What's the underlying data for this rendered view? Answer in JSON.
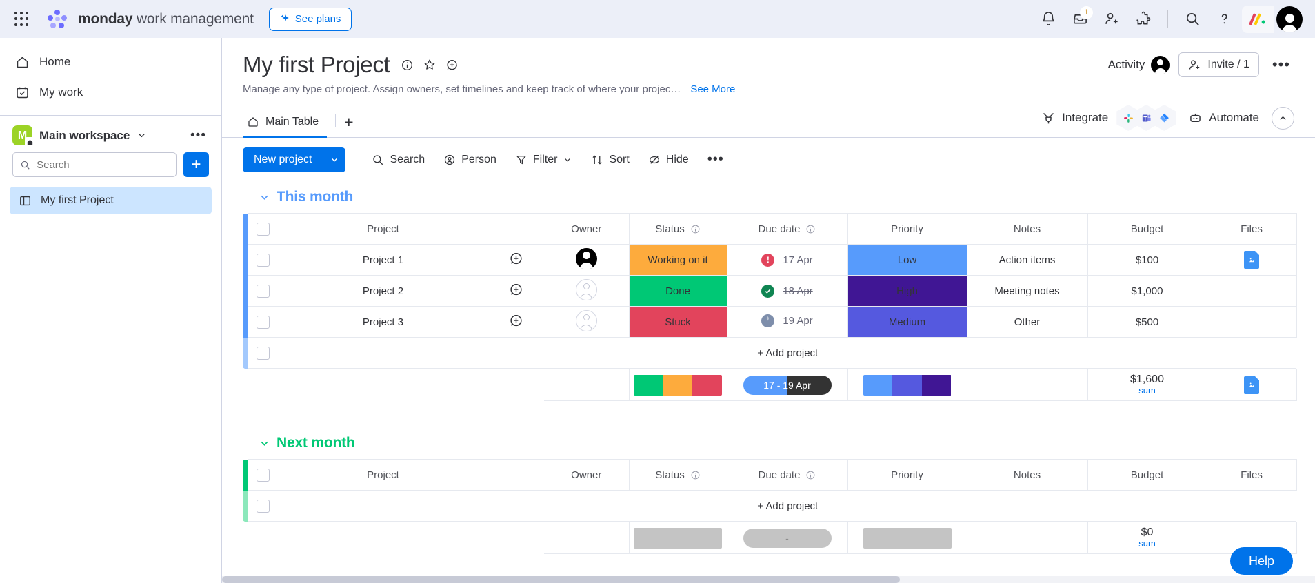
{
  "topbar": {
    "brand_bold": "monday",
    "brand_rest": " work management",
    "see_plans": "See plans",
    "icons": [
      {
        "name": "apps-grid-icon"
      },
      {
        "name": "notifications-bell-icon"
      },
      {
        "name": "inbox-icon",
        "badge": "1"
      },
      {
        "name": "invite-member-icon"
      },
      {
        "name": "apps-marketplace-icon"
      },
      {
        "name": "search-icon"
      },
      {
        "name": "help-question-icon"
      },
      {
        "name": "monday-product-switcher-icon"
      },
      {
        "name": "user-avatar"
      }
    ],
    "inbox_badge": "1"
  },
  "sidebar": {
    "nav": [
      {
        "label": "Home",
        "icon": "home-icon"
      },
      {
        "label": "My work",
        "icon": "my-work-calendar-icon"
      }
    ],
    "workspace": {
      "initial": "M",
      "name": "Main workspace",
      "menu": "•••"
    },
    "search_placeholder": "Search",
    "add_label": "+",
    "boards": [
      {
        "label": "My first Project",
        "icon": "board-icon",
        "selected": true
      }
    ]
  },
  "board": {
    "title": "My first Project",
    "description": "Manage any type of project. Assign owners, set timelines and keep track of where your projec…",
    "see_more": "See More",
    "activity_label": "Activity",
    "invite_label": "Invite / 1",
    "more_label": "•••"
  },
  "tabs": {
    "items": [
      {
        "label": "Main Table",
        "icon": "home-icon",
        "active": true
      }
    ],
    "add_label": "+",
    "integrate_label": "Integrate",
    "automate_label": "Automate",
    "integrations": [
      "slack-icon",
      "teams-icon",
      "jira-icon"
    ]
  },
  "toolbar": {
    "new_project": "New project",
    "items": [
      {
        "label": "Search",
        "icon": "search-icon"
      },
      {
        "label": "Person",
        "icon": "person-icon"
      },
      {
        "label": "Filter",
        "icon": "filter-icon",
        "caret": true
      },
      {
        "label": "Sort",
        "icon": "sort-icon"
      },
      {
        "label": "Hide",
        "icon": "hide-eye-icon"
      }
    ],
    "more": "•••"
  },
  "columns": [
    "Project",
    "Owner",
    "Status",
    "Due date",
    "Priority",
    "Notes",
    "Budget",
    "Files"
  ],
  "groups": [
    {
      "name": "This month",
      "color": "#579bfc",
      "add_row_label": "+ Add project",
      "rows": [
        {
          "project": "Project 1",
          "owner": "filled",
          "status": {
            "label": "Working on it",
            "color": "#fdab3d"
          },
          "due": {
            "date": "17 Apr",
            "indicator": "overdue",
            "indicator_color": "#e2445c",
            "struck": false
          },
          "priority": {
            "label": "Low",
            "color": "#579bfc"
          },
          "notes": "Action items",
          "budget": "$100",
          "file": true
        },
        {
          "project": "Project 2",
          "owner": "empty",
          "status": {
            "label": "Done",
            "color": "#00c875"
          },
          "due": {
            "date": "18 Apr",
            "indicator": "done",
            "indicator_color": "#0f8552",
            "struck": true
          },
          "priority": {
            "label": "High",
            "color": "#401694"
          },
          "notes": "Meeting notes",
          "budget": "$1,000",
          "file": false
        },
        {
          "project": "Project 3",
          "owner": "empty",
          "status": {
            "label": "Stuck",
            "color": "#e2445c"
          },
          "due": {
            "date": "19 Apr",
            "indicator": "pending",
            "indicator_color": "#7e8eab",
            "struck": false
          },
          "priority": {
            "label": "Medium",
            "color": "#5559df"
          },
          "notes": "Other",
          "budget": "$500",
          "file": false
        }
      ],
      "summary": {
        "status_bar": [
          {
            "color": "#00c875",
            "pct": 33.3
          },
          {
            "color": "#fdab3d",
            "pct": 33.3
          },
          {
            "color": "#e2445c",
            "pct": 33.4
          }
        ],
        "date_pill": {
          "text": "17 - 19 Apr",
          "left_color": "#579bfc",
          "right_color": "#333333",
          "fill_pct": 50
        },
        "priority_bar": [
          {
            "color": "#579bfc",
            "pct": 33.3
          },
          {
            "color": "#5559df",
            "pct": 33.3
          },
          {
            "color": "#401694",
            "pct": 33.4
          }
        ],
        "budget_value": "$1,600",
        "budget_label": "sum",
        "file": true
      }
    },
    {
      "name": "Next month",
      "color": "#00c875",
      "add_row_label": "+ Add project",
      "rows": [],
      "summary": {
        "status_bar": [
          {
            "color": "#c4c4c4",
            "pct": 100
          }
        ],
        "date_pill": {
          "text": "-",
          "left_color": "#c4c4c4",
          "right_color": "#c4c4c4",
          "fill_pct": 100
        },
        "priority_bar": [
          {
            "color": "#c4c4c4",
            "pct": 100
          }
        ],
        "budget_value": "$0",
        "budget_label": "sum",
        "file": false
      }
    }
  ],
  "help": {
    "label": "Help"
  }
}
